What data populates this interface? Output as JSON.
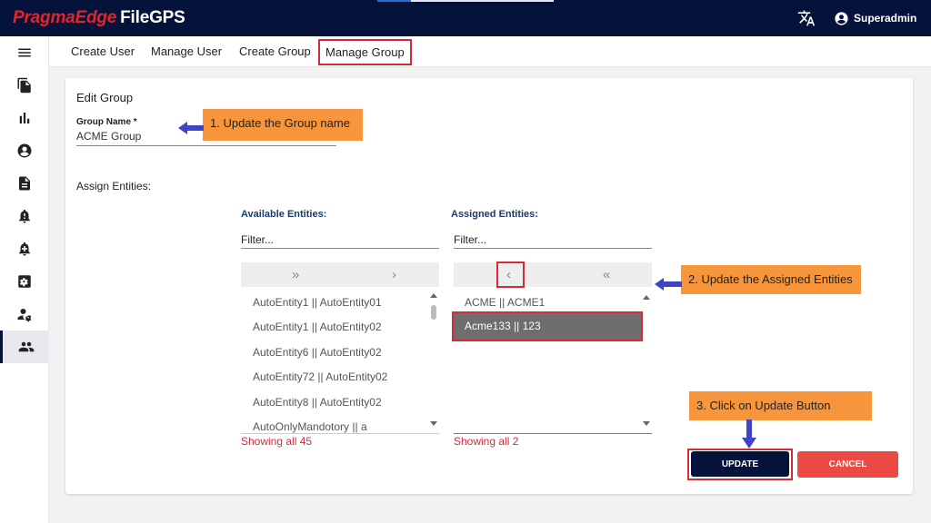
{
  "header": {
    "brand_part1": "PragmaEdge",
    "brand_part2": "FileGPS",
    "user_name": "Superadmin",
    "progress_fraction": 0.19
  },
  "sidebar": {
    "items": [
      {
        "icon": "menu-icon"
      },
      {
        "icon": "files-icon"
      },
      {
        "icon": "bar-chart-icon"
      },
      {
        "icon": "user-circle-icon"
      },
      {
        "icon": "document-icon"
      },
      {
        "icon": "bell-alert-icon"
      },
      {
        "icon": "bell-add-icon"
      },
      {
        "icon": "settings-box-icon"
      },
      {
        "icon": "user-settings-icon"
      },
      {
        "icon": "group-icon",
        "active": true
      }
    ]
  },
  "tabs": [
    {
      "label": "Create User"
    },
    {
      "label": "Manage User"
    },
    {
      "label": "Create Group"
    },
    {
      "label": "Manage Group",
      "active": true
    }
  ],
  "form": {
    "title": "Edit Group",
    "group_name_label": "Group Name *",
    "group_name_value": "ACME Group",
    "assign_label": "Assign Entities:"
  },
  "available": {
    "title": "Available Entities:",
    "filter_placeholder": "Filter...",
    "move_all_glyph": "»",
    "move_one_glyph": "›",
    "items": [
      "AutoEntity1 || AutoEntity01",
      "AutoEntity1 || AutoEntity02",
      "AutoEntity6 || AutoEntity02",
      "AutoEntity72 || AutoEntity02",
      "AutoEntity8 || AutoEntity02",
      "AutoOnlyMandotory || a"
    ],
    "showing": "Showing all 45"
  },
  "assigned": {
    "title": "Assigned Entities:",
    "filter_placeholder": "Filter...",
    "remove_one_glyph": "‹",
    "remove_all_glyph": "«",
    "items": [
      "ACME || ACME1",
      "Acme133 || 123"
    ],
    "selected_index": 1,
    "showing": "Showing all 2"
  },
  "actions": {
    "update_label": "UPDATE",
    "cancel_label": "CANCEL"
  },
  "callouts": {
    "step1": "1. Update the Group name",
    "step2": "2. Update the Assigned Entities",
    "step3": "3. Click on Update Button"
  },
  "colors": {
    "topbar": "#05133a",
    "brand_red": "#e3252b",
    "callout": "#f6953b",
    "highlight_red": "#d42b36",
    "update_btn": "#05133a",
    "cancel_btn": "#ec4a45",
    "arrow_blue": "#3f44c8"
  }
}
